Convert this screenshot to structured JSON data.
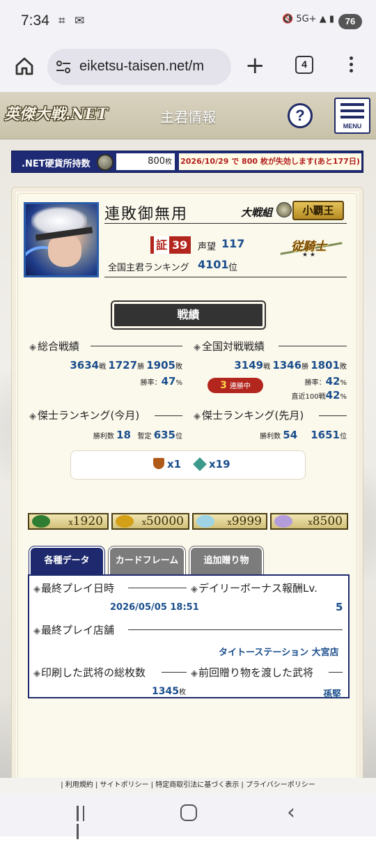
{
  "status_bar": {
    "time": "7:34",
    "net": "5G+",
    "battery": "76"
  },
  "browser": {
    "url": "eiketsu-taisen.net/m",
    "tab_count": "4"
  },
  "header": {
    "logo": "英傑大戦.NET",
    "title": "主君情報",
    "help": "?",
    "menu": "MENU"
  },
  "coin": {
    "label": ".NET硬貨所持数",
    "amount": "800",
    "unit": "枚",
    "expiry": "2026/10/29 で 800 枚が失効します(あと177日)"
  },
  "profile": {
    "name": "連敗御無用",
    "group_label": "大戦組",
    "group_name": "小覇王",
    "shou_label": "証",
    "shou_value": "39",
    "meisei_label": "声望",
    "meisei_value": "117",
    "rank_label": "全国主君ランキング",
    "rank_value": "4101",
    "rank_unit": "位",
    "title_badge": "従騎士"
  },
  "section_title": "戦績",
  "stats": {
    "overall": {
      "title": "総合戦績",
      "games": "3634",
      "games_u": "戦",
      "wins": "1727",
      "wins_u": "勝",
      "losses": "1905",
      "losses_u": "敗",
      "rate_label": "勝率：",
      "rate": "47",
      "rate_u": "%"
    },
    "national": {
      "title": "全国対戦戦績",
      "games": "3149",
      "games_u": "戦",
      "wins": "1346",
      "wins_u": "勝",
      "losses": "1801",
      "losses_u": "敗",
      "rate_label": "勝率：",
      "rate": "42",
      "rate_u": "%",
      "recent_label": "直近100戦",
      "recent": "42",
      "recent_u": "%",
      "streak": "3",
      "streak_label": "連勝中"
    },
    "rank_this_month": {
      "title": "傑士ランキング(今月)",
      "wins_label": "勝利数",
      "wins": "18",
      "rank_label": "暫定",
      "rank": "635",
      "rank_u": "位"
    },
    "rank_last_month": {
      "title": "傑士ランキング(先月)",
      "wins_label": "勝利数",
      "wins": "54",
      "rank": "1651",
      "rank_u": "位"
    }
  },
  "medals": {
    "trophy": "x1",
    "gem": "x19"
  },
  "resources": [
    {
      "icon": "dragon-icon",
      "x": "x",
      "value": "1920",
      "color": "#2e7d32"
    },
    {
      "icon": "coin-icon",
      "x": "x",
      "value": "50000",
      "color": "#d4a017"
    },
    {
      "icon": "crystal-icon",
      "x": "x",
      "value": "9999",
      "color": "#9fd3e6"
    },
    {
      "icon": "flower-icon",
      "x": "x",
      "value": "8500",
      "color": "#b39ddb"
    }
  ],
  "tabs": [
    {
      "label": "各種データ"
    },
    {
      "label": "カードフレーム"
    },
    {
      "label": "追加贈り物"
    }
  ],
  "details": {
    "last_play_label": "最終プレイ日時",
    "last_play": "2026/05/05 18:51",
    "daily_bonus_label": "デイリーボーナス報酬Lv.",
    "daily_bonus": "5",
    "last_shop_label": "最終プレイ店舗",
    "last_shop": "タイトーステーション 大宮店",
    "printed_label": "印刷した武将の総枚数",
    "printed": "1345",
    "printed_u": "枚",
    "gift_label": "前回贈り物を渡した武将",
    "gift": "孫堅"
  },
  "footer": {
    "text": "| 利用規約 | サイトポリシー | 特定商取引法に基づく表示 | プライバシーポリシー"
  }
}
